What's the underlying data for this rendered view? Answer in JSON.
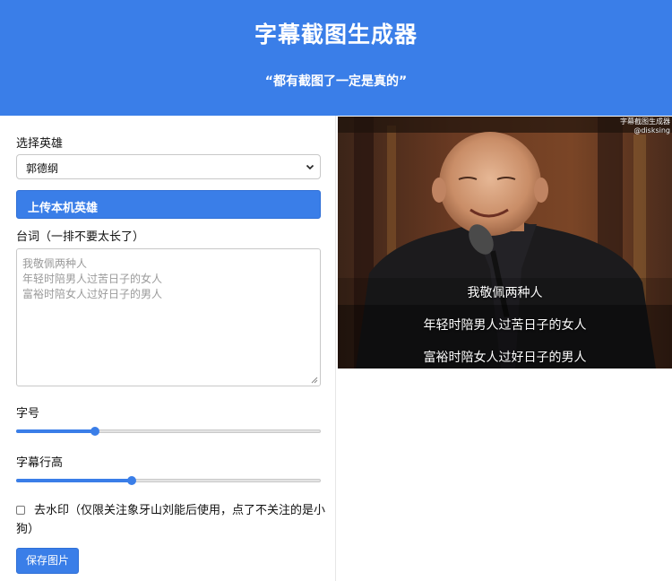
{
  "header": {
    "title": "字幕截图生成器",
    "slogan": "“都有截图了一定是真的”"
  },
  "form": {
    "hero_label": "选择英雄",
    "hero_selected": "郭德纲",
    "upload_label": "上传本机英雄",
    "lines_label": "台词（一排不要太长了）",
    "lines_placeholder": [
      "我敬佩两种人",
      "年轻时陪男人过苦日子的女人",
      "富裕时陪女人过好日子的男人"
    ],
    "font_size_label": "字号",
    "font_size_value": 0.26,
    "line_height_label": "字幕行高",
    "line_height_value": 0.38,
    "remove_watermark_label": "去水印（仅限关注象牙山刘能后使用，点了不关注的是小狗）",
    "remove_watermark_checked": false,
    "save_label": "保存图片"
  },
  "preview": {
    "watermark_line1": "字幕截图生成器",
    "watermark_line2": "@disksing",
    "subtitles": [
      "我敬佩两种人",
      "年轻时陪男人过苦日子的女人",
      "富裕时陪女人过好日子的男人"
    ]
  },
  "colors": {
    "accent": "#3a7ee8"
  }
}
